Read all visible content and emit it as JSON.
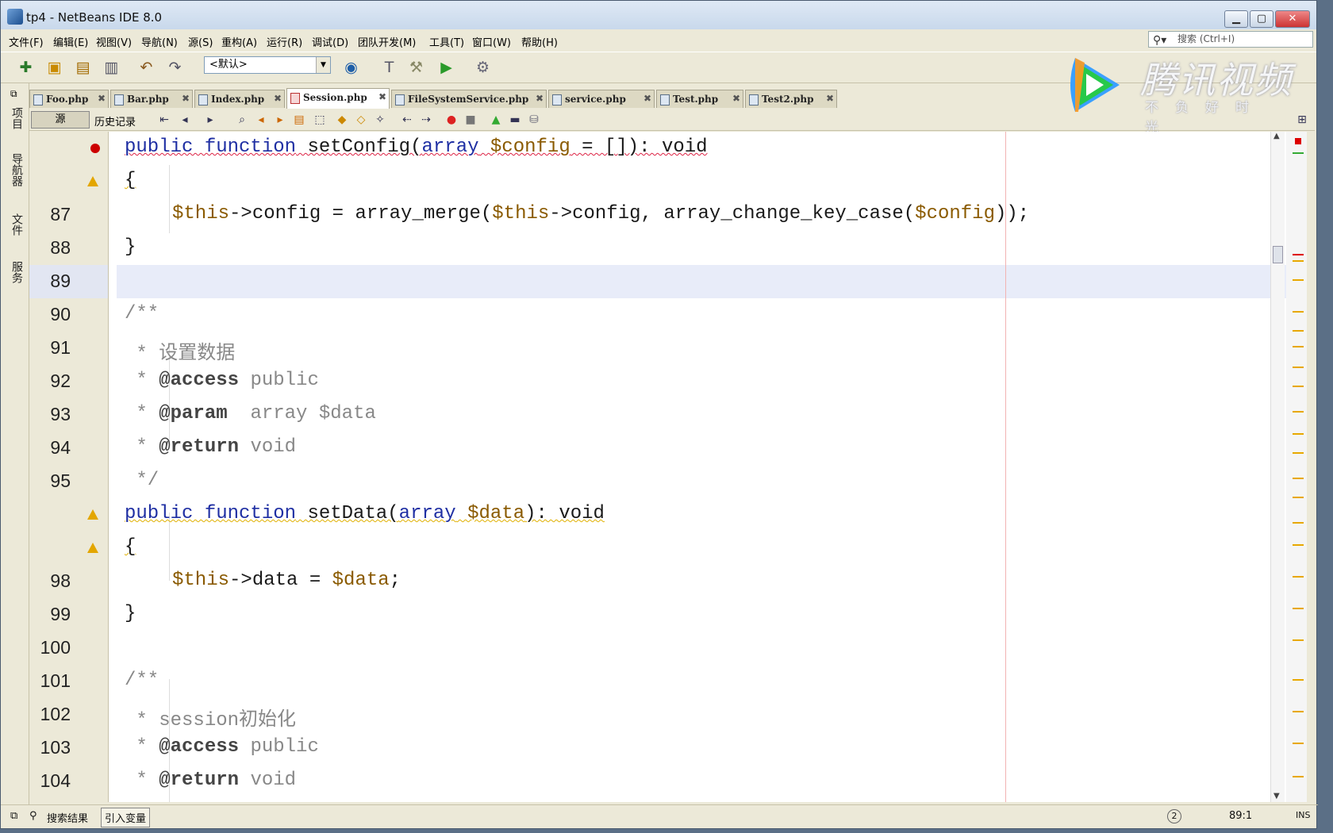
{
  "window": {
    "title": "tp4 - NetBeans IDE 8.0",
    "min": "▁",
    "max": "▢",
    "close": "✕"
  },
  "menu": [
    "文件(F)",
    "编辑(E)",
    "视图(V)",
    "导航(N)",
    "源(S)",
    "重构(A)",
    "运行(R)",
    "调试(D)",
    "团队开发(M)",
    "工具(T)",
    "窗口(W)",
    "帮助(H)"
  ],
  "search": {
    "placeholder": "搜索 (Ctrl+I)"
  },
  "toolbar": {
    "config": "<默认>"
  },
  "watermark": {
    "brand": "腾讯视频",
    "slogan": "不负好时光"
  },
  "tabs": [
    "Foo.php",
    "Bar.php",
    "Index.php",
    "Session.php",
    "FileSystemService.php",
    "service.php",
    "Test.php",
    "Test2.php"
  ],
  "activeTab": "Session.php",
  "editor_tabs": {
    "source": "源",
    "history": "历史记录"
  },
  "sidebar": {
    "projects": "项目",
    "navigator": "导航器",
    "files": "文件",
    "services": "服务"
  },
  "code": {
    "l1": {
      "num": "",
      "pre": "",
      "kw": "public function",
      "mid": " setConfig(",
      "kw2": "array",
      "var": " $config",
      "tail": " = []): void"
    },
    "l2": {
      "num": "",
      "text": "{"
    },
    "l3": {
      "num": "87",
      "v1": "$this",
      "a": "->config = array_merge(",
      "v2": "$this",
      "b": "->config, array_change_key_case(",
      "v3": "$config",
      "c": "));"
    },
    "l4": {
      "num": "88",
      "text": "}"
    },
    "l5": {
      "num": "89",
      "text": ""
    },
    "l6": {
      "num": "90",
      "text": "/**"
    },
    "l7": {
      "num": "91",
      "text": " * 设置数据"
    },
    "l8": {
      "num": "92",
      "star": " * ",
      "tag": "@access",
      "rest": " public"
    },
    "l9": {
      "num": "93",
      "star": " * ",
      "tag": "@param",
      "rest": "  array $data"
    },
    "l10": {
      "num": "94",
      "star": " * ",
      "tag": "@return",
      "rest": " void"
    },
    "l11": {
      "num": "95",
      "text": " */"
    },
    "l12": {
      "num": "",
      "kw": "public function",
      "mid": " setData(",
      "kw2": "array",
      "var": " $data",
      "tail": "): void"
    },
    "l13": {
      "num": "",
      "text": "{"
    },
    "l14": {
      "num": "98",
      "v1": "$this",
      "a": "->data = ",
      "v2": "$data",
      "b": ";"
    },
    "l15": {
      "num": "99",
      "text": "}"
    },
    "l16": {
      "num": "100",
      "text": ""
    },
    "l17": {
      "num": "101",
      "text": "/**"
    },
    "l18": {
      "num": "102",
      "text": " * session初始化"
    },
    "l19": {
      "num": "103",
      "star": " * ",
      "tag": "@access",
      "rest": " public"
    },
    "l20": {
      "num": "104",
      "star": " * ",
      "tag": "@return",
      "rest": " void"
    }
  },
  "status": {
    "search_results": "搜索结果",
    "introduce_var": "引入变量",
    "position": "89:1",
    "mode": "INS"
  }
}
